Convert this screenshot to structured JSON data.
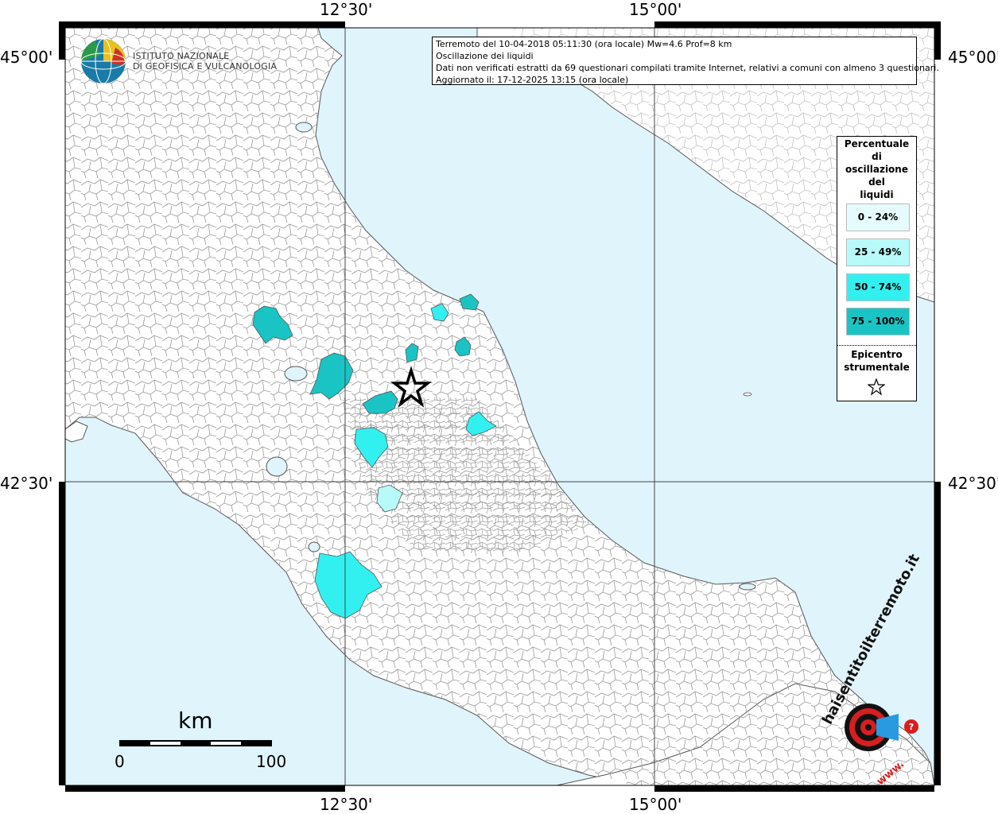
{
  "map": {
    "lat_labels": [
      "45°00'",
      "42°30'"
    ],
    "lon_labels": [
      "12°30'",
      "15°00'"
    ],
    "colors": {
      "sea": "#e0f4fc",
      "land": "#ffffff",
      "border": "#9a9a9a",
      "class_0_24": "#e6fcfc",
      "class_25_49": "#b8fafa",
      "class_50_74": "#33f0f0",
      "class_75_100": "#1ac4c4"
    }
  },
  "logo": {
    "line1": "ISTITUTO NAZIONALE",
    "line2": "DI GEOFISICA E VULCANOLOGIA"
  },
  "info": {
    "line1": "Terremoto del 10-04-2018 05:11:30 (ora locale) Mw=4.6 Prof=8 km",
    "line2": "Oscillazione dei liquidi",
    "line3": "Dati non verificati estratti da 69 questionari compilati tramite Internet, relativi a comuni con almeno 3 questionari.",
    "line4": "Aggiornato il: 17-12-2025 13:15 (ora locale)"
  },
  "legend": {
    "title_l1": "Percentuale",
    "title_l2": "di",
    "title_l3": "oscillazione",
    "title_l4": "del",
    "title_l5": "liquidi",
    "classes": [
      "0 - 24%",
      "25 - 49%",
      "50 - 74%",
      "75 - 100%"
    ],
    "epicenter_l1": "Epicentro",
    "epicenter_l2": "strumentale"
  },
  "scale": {
    "unit": "km",
    "min": "0",
    "max": "100"
  },
  "brand": {
    "text_main": "haisentitoilterremoto.it",
    "text_www": "www."
  }
}
